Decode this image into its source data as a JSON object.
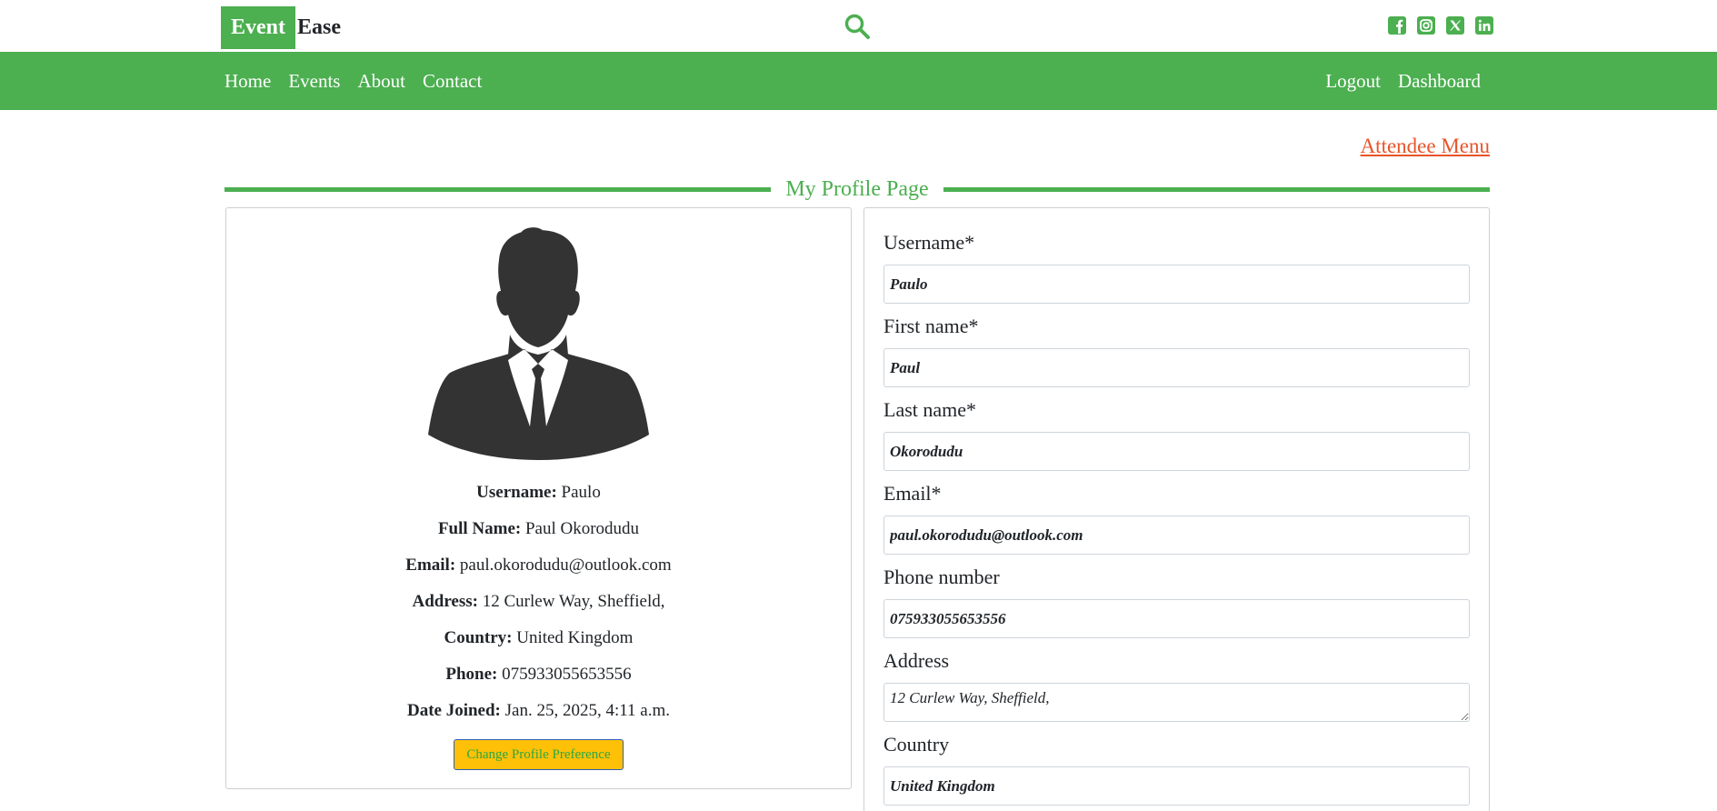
{
  "brand": {
    "part1": "Event",
    "part2": "Ease"
  },
  "topbar": {
    "search_icon": "magnifier-icon",
    "socials": [
      "facebook-icon",
      "instagram-icon",
      "x-icon",
      "linkedin-icon"
    ]
  },
  "nav": {
    "left": [
      "Home",
      "Events",
      "About",
      "Contact"
    ],
    "right": [
      "Logout",
      "Dashboard"
    ]
  },
  "attendee_menu": "Attendee Menu",
  "page_title": "My Profile Page",
  "profile": {
    "avatar_icon": "person-silhouette-icon",
    "rows": [
      {
        "label": "Username:",
        "value": "Paulo"
      },
      {
        "label": "Full Name:",
        "value": "Paul Okorodudu"
      },
      {
        "label": "Email:",
        "value": "paul.okorodudu@outlook.com"
      },
      {
        "label": "Address:",
        "value": "12 Curlew Way, Sheffield,"
      },
      {
        "label": "Country:",
        "value": "United Kingdom"
      },
      {
        "label": "Phone:",
        "value": "075933055653556"
      },
      {
        "label": "Date Joined:",
        "value": "Jan. 25, 2025, 4:11 a.m."
      }
    ],
    "change_button": "Change Profile Preference"
  },
  "form": {
    "username": {
      "label": "Username*",
      "value": "Paulo"
    },
    "first_name": {
      "label": "First name*",
      "value": "Paul"
    },
    "last_name": {
      "label": "Last name*",
      "value": "Okorodudu"
    },
    "email": {
      "label": "Email*",
      "value": "paul.okorodudu@outlook.com"
    },
    "phone": {
      "label": "Phone number",
      "value": "075933055653556"
    },
    "address": {
      "label": "Address",
      "value": "12 Curlew Way, Sheffield,"
    },
    "country": {
      "label": "Country",
      "value": "United Kingdom"
    }
  },
  "colors": {
    "brand_green": "#4caf50",
    "link_orange": "#e8542a",
    "button_yellow": "#ffc107"
  }
}
